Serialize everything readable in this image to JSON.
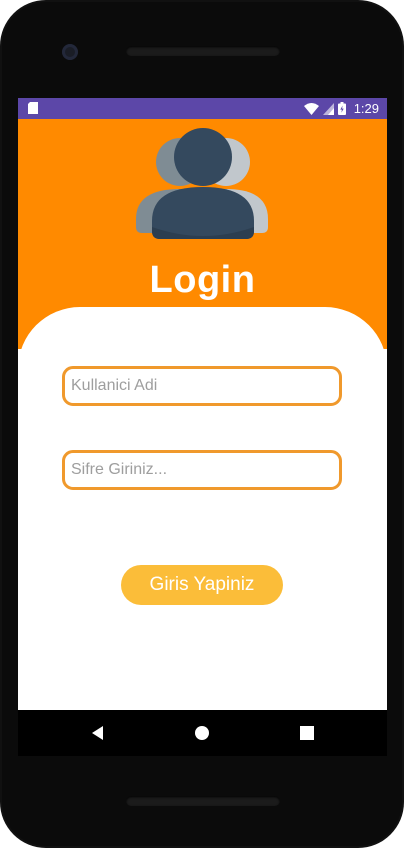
{
  "status_bar": {
    "time": "1:29",
    "color": "#5c47a8",
    "icons": [
      "sd-card-icon",
      "wifi-icon",
      "signal-icon",
      "battery-icon"
    ]
  },
  "header": {
    "title": "Login",
    "background": "#ff8a00",
    "icon": "users-group-icon"
  },
  "form": {
    "username_placeholder": "Kullanici Adi",
    "password_placeholder": "Sifre Giriniz...",
    "username_value": "",
    "password_value": "",
    "submit_label": "Giris Yapiniz",
    "field_border_color": "#f0992c",
    "button_color": "#fbbd39"
  },
  "nav_bar": {
    "icons": [
      "back-icon",
      "home-icon",
      "recents-icon"
    ]
  }
}
